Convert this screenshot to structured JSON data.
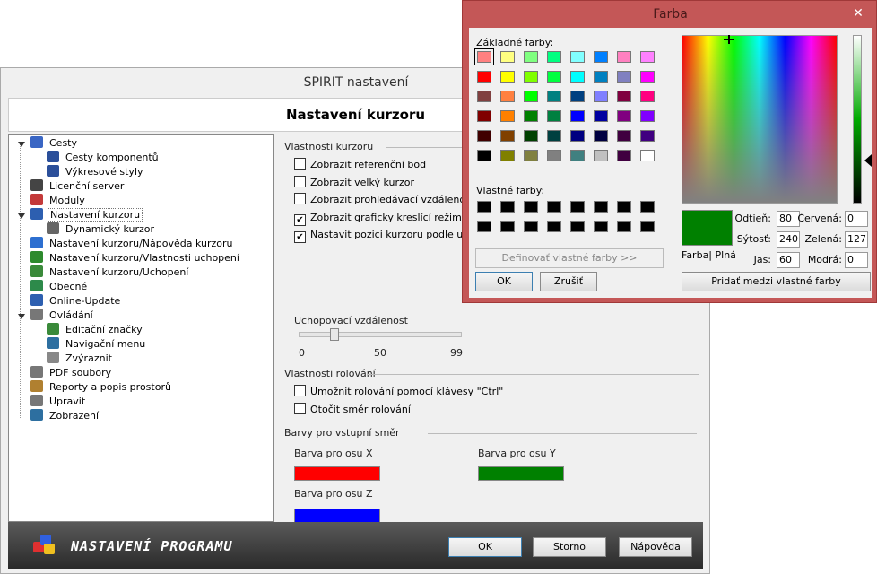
{
  "main": {
    "title": "SPIRIT nastavení",
    "header_title": "Nastavení kurzoru",
    "tree": [
      {
        "label": "Cesty",
        "icon": "folder-blue-icon",
        "color": "#3a66c4"
      },
      {
        "label": "Cesty komponentů",
        "icon": "component-icon",
        "color": "#2b4f9a"
      },
      {
        "label": "Výkresové styly",
        "icon": "style-icon",
        "color": "#2b4f9a"
      },
      {
        "label": "Licenční server",
        "icon": "key-icon",
        "color": "#444444"
      },
      {
        "label": "Moduly",
        "icon": "modules-icon",
        "color": "#c43a3a"
      },
      {
        "label": "Nastavení kurzoru",
        "icon": "cursor-icon",
        "color": "#2d5fb0"
      },
      {
        "label": "Dynamický kurzor",
        "icon": "pencil-icon",
        "color": "#666666"
      },
      {
        "label": "Nastavení kurzoru/Nápověda kurzoru",
        "icon": "help-icon",
        "color": "#2d6fd0"
      },
      {
        "label": "Nastavení kurzoru/Vlastnosti uchopení",
        "icon": "snap-icon",
        "color": "#2d8a2d"
      },
      {
        "label": "Nastavení kurzoru/Uchopení",
        "icon": "crosshair-icon",
        "color": "#3a8a3a"
      },
      {
        "label": "Obecné",
        "icon": "globe-icon",
        "color": "#2d8a4a"
      },
      {
        "label": "Online-Update",
        "icon": "update-icon",
        "color": "#2d5fb0"
      },
      {
        "label": "Ovládání",
        "icon": "controls-icon",
        "color": "#777777"
      },
      {
        "label": "Editační značky",
        "icon": "edit-marks-icon",
        "color": "#3a8a3a"
      },
      {
        "label": "Navigační menu",
        "icon": "navigation-icon",
        "color": "#2d6fa0"
      },
      {
        "label": "Zvýraznit",
        "icon": "highlight-icon",
        "color": "#888888"
      },
      {
        "label": "PDF soubory",
        "icon": "pdf-icon",
        "color": "#777777"
      },
      {
        "label": "Reporty a popis prostorů",
        "icon": "report-icon",
        "color": "#b08030"
      },
      {
        "label": "Upravit",
        "icon": "edit-icon",
        "color": "#777777"
      },
      {
        "label": "Zobrazení",
        "icon": "display-icon",
        "color": "#2d6fa0"
      }
    ],
    "sections": {
      "cursor_props": "Vlastnosti kurzoru",
      "snap_distance": "Uchopovací vzdálenost",
      "scroll_props": "Vlastnosti rolování",
      "input_colors": "Barvy pro vstupní směr"
    },
    "checkboxes": [
      {
        "label": "Zobrazit referenční bod",
        "checked": false
      },
      {
        "label": "Zobrazit velký kurzor",
        "checked": false
      },
      {
        "label": "Zobrazit prohledávací vzdálenost ku",
        "checked": false
      },
      {
        "label": "Zobrazit graficky kreslící režim na ku",
        "checked": true
      },
      {
        "label": "Nastavit pozici kurzoru podle uchopo",
        "checked": true
      }
    ],
    "slider": {
      "min_label": "0",
      "mid_label": "50",
      "max_label": "99",
      "value": 5
    },
    "scroll_checkboxes": [
      {
        "label": "Umožnit rolování pomocí klávesy \"Ctrl\"",
        "checked": false
      },
      {
        "label": "Otočit směr rolování",
        "checked": false
      }
    ],
    "axis_colors": [
      {
        "label": "Barva pro osu X",
        "color": "#ff0000"
      },
      {
        "label": "Barva pro osu Y",
        "color": "#008000"
      },
      {
        "label": "Barva pro osu Z",
        "color": "#0000ff"
      }
    ],
    "brand": "NASTAVENÍ PROGRAMU",
    "ok": "OK",
    "cancel": "Storno",
    "help": "Nápověda"
  },
  "dialog": {
    "title": "Farba",
    "close": "✕",
    "basic_label": "Základné farby:",
    "custom_label": "Vlastné farby:",
    "define_btn": "Definovať vlastné farby >>",
    "ok": "OK",
    "cancel": "Zrušiť",
    "preview_label": "Farba| Plná",
    "preview_color": "#008000",
    "hue_label": "Odtieň:",
    "hue": "80",
    "sat_label": "Sýtosť:",
    "sat": "240",
    "lum_label": "Jas:",
    "lum": "60",
    "red_label": "Červená:",
    "red": "0",
    "green_label": "Zelená:",
    "green": "127",
    "blue_label": "Modrá:",
    "blue": "0",
    "add_btn": "Pridať medzi vlastné farby",
    "basic_colors": [
      "#ff8080",
      "#ffff80",
      "#80ff80",
      "#00ff80",
      "#80ffff",
      "#0080ff",
      "#ff80c0",
      "#ff80ff",
      "#ff0000",
      "#ffff00",
      "#80ff00",
      "#00ff40",
      "#00ffff",
      "#0080c0",
      "#8080c0",
      "#ff00ff",
      "#804040",
      "#ff8040",
      "#00ff00",
      "#008080",
      "#004080",
      "#8080ff",
      "#800040",
      "#ff0080",
      "#800000",
      "#ff8000",
      "#008000",
      "#008040",
      "#0000ff",
      "#0000a0",
      "#800080",
      "#8000ff",
      "#400000",
      "#804000",
      "#004000",
      "#004040",
      "#000080",
      "#000040",
      "#400040",
      "#400080",
      "#000000",
      "#808000",
      "#808040",
      "#808080",
      "#408080",
      "#c0c0c0",
      "#400040",
      "#ffffff"
    ],
    "custom_colors": [
      "#000000",
      "#000000",
      "#000000",
      "#000000",
      "#000000",
      "#000000",
      "#000000",
      "#000000",
      "#000000",
      "#000000",
      "#000000",
      "#000000",
      "#000000",
      "#000000",
      "#000000",
      "#000000"
    ]
  }
}
